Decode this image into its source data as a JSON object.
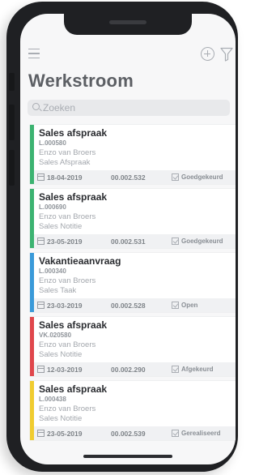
{
  "header": {
    "title": "Werkstroom",
    "icons": {
      "menu": "menu-icon",
      "add": "add-icon",
      "filter": "filter-icon"
    }
  },
  "search": {
    "placeholder": "Zoeken"
  },
  "cards": [
    {
      "title": "Sales afspraak",
      "code": "L.000580",
      "person": "Enzo van Broers",
      "type": "Sales Afspraak",
      "date": "18-04-2019",
      "amount": "00.002.532",
      "status": "Goedgekeurd",
      "color": "#3cb371"
    },
    {
      "title": "Sales afspraak",
      "code": "L.000690",
      "person": "Enzo van Broers",
      "type": "Sales Notitie",
      "date": "23-05-2019",
      "amount": "00.002.531",
      "status": "Goedgekeurd",
      "color": "#3cb371"
    },
    {
      "title": "Vakantieaanvraag",
      "code": "L.000340",
      "person": "Enzo van Broers",
      "type": "Sales Taak",
      "date": "23-03-2019",
      "amount": "00.002.528",
      "status": "Open",
      "color": "#3a9ad9"
    },
    {
      "title": "Sales afspraak",
      "code": "VK.020580",
      "person": "Enzo van Broers",
      "type": "Sales Notitie",
      "date": "12-03-2019",
      "amount": "00.002.290",
      "status": "Afgekeurd",
      "color": "#e0474c"
    },
    {
      "title": "Sales afspraak",
      "code": "L.000438",
      "person": "Enzo van Broers",
      "type": "Sales Notitie",
      "date": "23-05-2019",
      "amount": "00.002.539",
      "status": "Gerealiseerd",
      "color": "#f0cc30"
    }
  ]
}
